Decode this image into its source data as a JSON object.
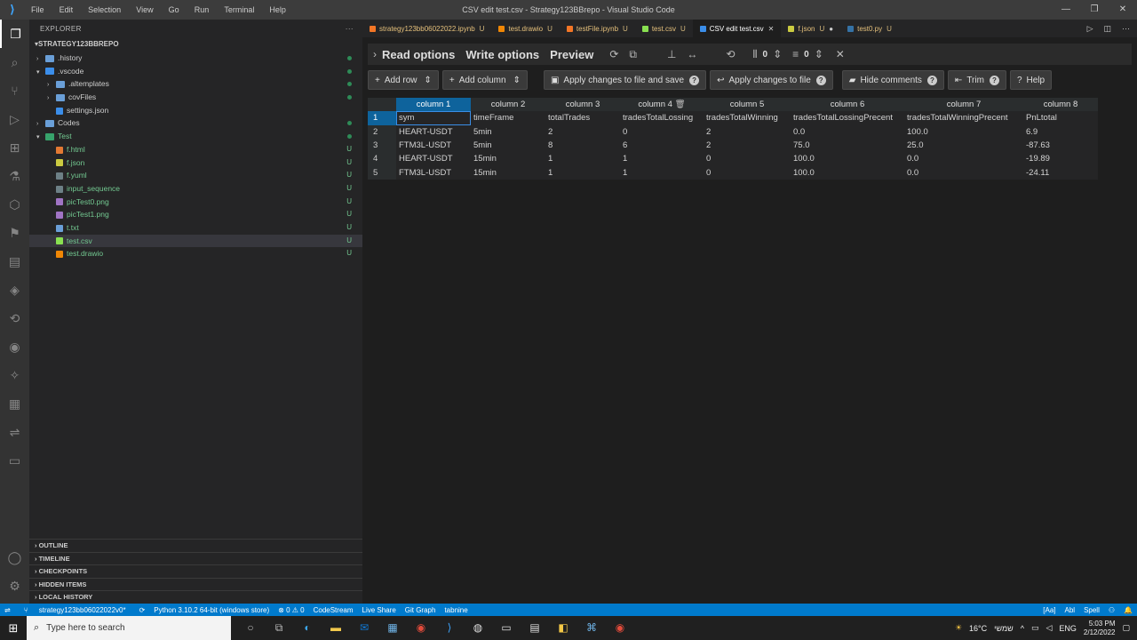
{
  "window": {
    "title": "CSV edit test.csv - Strategy123BBrepo - Visual Studio Code",
    "menu": [
      "File",
      "Edit",
      "Selection",
      "View",
      "Go",
      "Run",
      "Terminal",
      "Help"
    ]
  },
  "sidebar": {
    "header": "EXPLORER",
    "root": "STRATEGY123BBREPO",
    "items": [
      {
        "label": ".history",
        "badge": ""
      },
      {
        "label": ".vscode",
        "badge": ""
      },
      {
        "label": ".altemplates",
        "badge": ""
      },
      {
        "label": "covFiles",
        "badge": ""
      },
      {
        "label": "settings.json",
        "badge": ""
      },
      {
        "label": "Codes",
        "badge": ""
      },
      {
        "label": "Test",
        "badge": ""
      },
      {
        "label": "f.html",
        "badge": "U"
      },
      {
        "label": "f.json",
        "badge": "U"
      },
      {
        "label": "f.yuml",
        "badge": "U"
      },
      {
        "label": "input_sequence",
        "badge": "U"
      },
      {
        "label": "picTest0.png",
        "badge": "U"
      },
      {
        "label": "picTest1.png",
        "badge": "U"
      },
      {
        "label": "t.txt",
        "badge": "U"
      },
      {
        "label": "test.csv",
        "badge": "U"
      },
      {
        "label": "test.drawio",
        "badge": "U"
      }
    ],
    "sections": [
      "OUTLINE",
      "TIMELINE",
      "CHECKPOINTS",
      "HIDDEN ITEMS",
      "LOCAL HISTORY"
    ]
  },
  "tabs": [
    {
      "label": "strategy123bb06022022.ipynb",
      "status": "U"
    },
    {
      "label": "test.drawio",
      "status": "U"
    },
    {
      "label": "testFile.ipynb",
      "status": "U"
    },
    {
      "label": "test.csv",
      "status": "U"
    },
    {
      "label": "CSV edit test.csv",
      "status": ""
    },
    {
      "label": "f.json",
      "status": "U"
    },
    {
      "label": "test0.py",
      "status": "U"
    }
  ],
  "csv_toolbar": {
    "read_options": "Read options",
    "write_options": "Write options",
    "preview": "Preview",
    "header_count": "0",
    "right_count": "0"
  },
  "csv_toolbar2": {
    "add_row": "Add row",
    "add_column": "Add column",
    "apply_save": "Apply changes to file and save",
    "apply": "Apply changes to file",
    "hide_comments": "Hide comments",
    "trim": "Trim",
    "help": "Help"
  },
  "table": {
    "headers": [
      "column 1",
      "column 2",
      "column 3",
      "column 4",
      "column 5",
      "column 6",
      "column 7",
      "column 8"
    ],
    "rows": [
      [
        "1",
        "sym",
        "timeFrame",
        "totalTrades",
        "tradesTotalLossing",
        "tradesTotalWinning",
        "tradesTotalLossingPrecent",
        "tradesTotalWinningPrecent",
        "PnLtotal"
      ],
      [
        "2",
        "HEART-USDT",
        "5min",
        "2",
        "0",
        "2",
        "0.0",
        "100.0",
        "6.9"
      ],
      [
        "3",
        "FTM3L-USDT",
        "5min",
        "8",
        "6",
        "2",
        "75.0",
        "25.0",
        "-87.63"
      ],
      [
        "4",
        "HEART-USDT",
        "15min",
        "1",
        "1",
        "0",
        "100.0",
        "0.0",
        "-19.89"
      ],
      [
        "5",
        "FTM3L-USDT",
        "15min",
        "1",
        "1",
        "0",
        "100.0",
        "0.0",
        "-24.11"
      ]
    ]
  },
  "statusbar": {
    "branch": "strategy123bb06022022v0*",
    "python": "Python 3.10.2 64-bit (windows store)",
    "problems": "⊗ 0 ⚠ 0",
    "codestream": "CodeStream",
    "liveshare": "Live Share",
    "gitgraph": "Git Graph",
    "tabnine": "tabnine",
    "aa": "[Aa]",
    "abl": "Abl",
    "spell": "Spell"
  },
  "taskbar": {
    "search_placeholder": "Type here to search",
    "temp": "16°C",
    "weather_text": "שמשי",
    "lang": "ENG",
    "time": "5:03 PM",
    "date": "2/12/2022"
  }
}
